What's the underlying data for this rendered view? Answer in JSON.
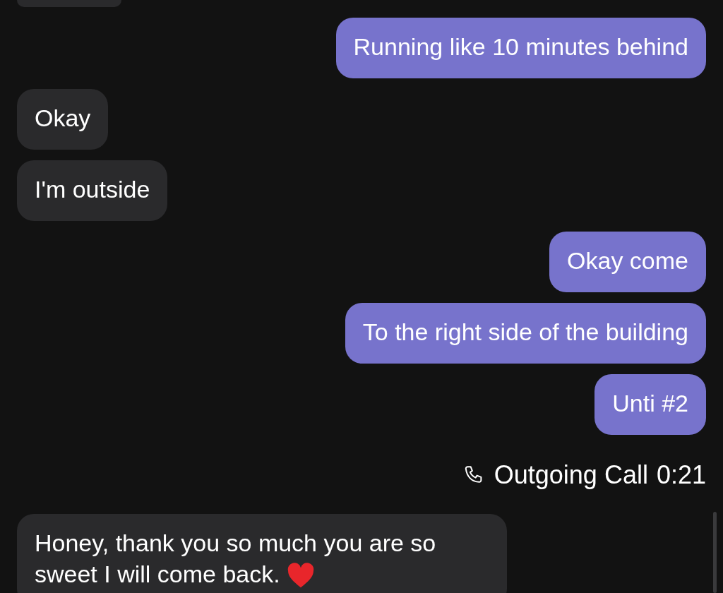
{
  "messages": [
    {
      "kind": "incoming_clipped"
    },
    {
      "kind": "outgoing",
      "text": "Running like 10 minutes behind"
    },
    {
      "kind": "incoming",
      "text": "Okay"
    },
    {
      "kind": "incoming",
      "text": "I'm outside"
    },
    {
      "kind": "outgoing",
      "text": "Okay come"
    },
    {
      "kind": "outgoing",
      "text": "To the right side of the building"
    },
    {
      "kind": "outgoing",
      "text": "Unti #2"
    },
    {
      "kind": "call",
      "label": "Outgoing Call",
      "duration": "0:21"
    },
    {
      "kind": "incoming",
      "text": "Honey, thank you so much you are so sweet I will come back.",
      "heart_emoji": true
    }
  ]
}
